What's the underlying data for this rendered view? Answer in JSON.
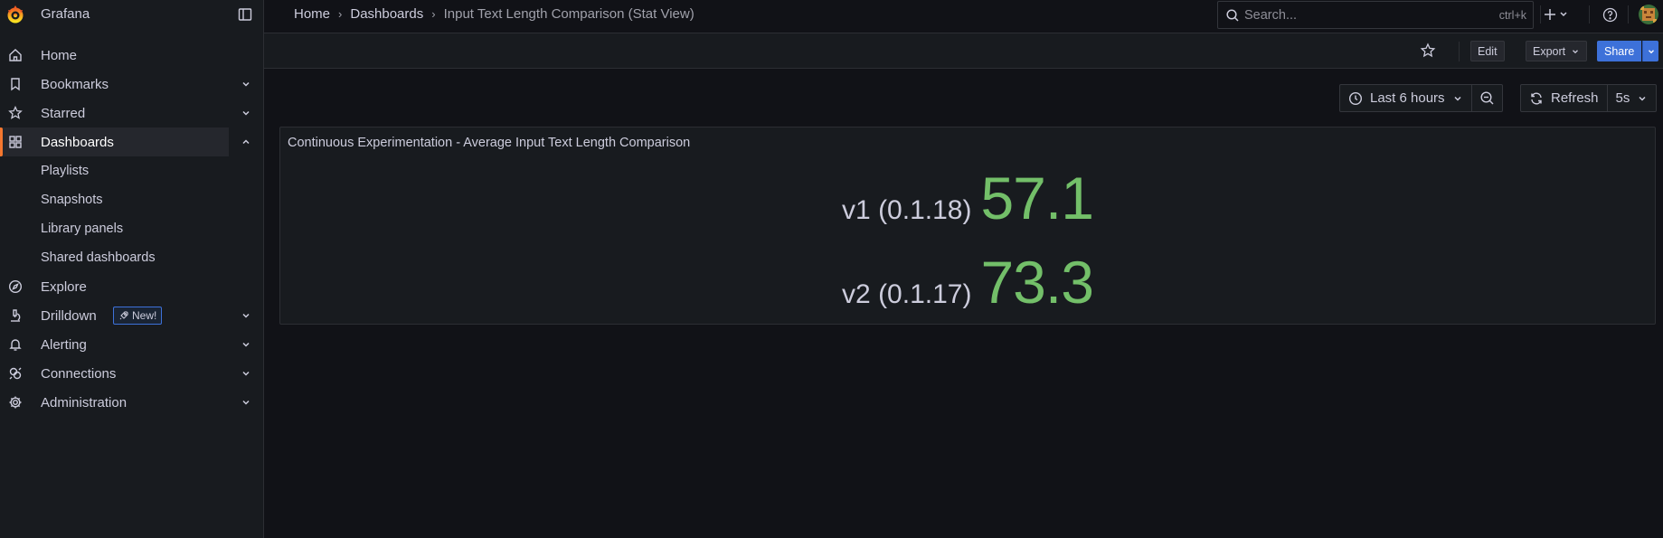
{
  "app": {
    "title": "Grafana"
  },
  "nav": {
    "items": [
      {
        "label": "Home",
        "icon": "home-icon"
      },
      {
        "label": "Bookmarks",
        "icon": "bookmark-icon"
      },
      {
        "label": "Starred",
        "icon": "star-icon"
      },
      {
        "label": "Dashboards",
        "icon": "apps-icon"
      },
      {
        "label": "Playlists"
      },
      {
        "label": "Snapshots"
      },
      {
        "label": "Library panels"
      },
      {
        "label": "Shared dashboards"
      },
      {
        "label": "Explore",
        "icon": "compass-icon"
      },
      {
        "label": "Drilldown",
        "icon": "microscope-icon",
        "badge": "New!"
      },
      {
        "label": "Alerting",
        "icon": "bell-icon"
      },
      {
        "label": "Connections",
        "icon": "plug-icon"
      },
      {
        "label": "Administration",
        "icon": "cog-icon"
      }
    ]
  },
  "breadcrumb": [
    {
      "label": "Home"
    },
    {
      "label": "Dashboards"
    },
    {
      "label": "Input Text Length Comparison (Stat View)"
    }
  ],
  "search": {
    "placeholder": "Search...",
    "shortcut": "ctrl+k"
  },
  "toolbar": {
    "edit_label": "Edit",
    "export_label": "Export",
    "share_label": "Share"
  },
  "time_controls": {
    "range_label": "Last 6 hours",
    "refresh_label": "Refresh",
    "interval_label": "5s"
  },
  "panel": {
    "title": "Continuous Experimentation - Average Input Text Length Comparison",
    "stats": [
      {
        "name": "v1 (0.1.18)",
        "value": "57.1"
      },
      {
        "name": "v2 (0.1.17)",
        "value": "73.3"
      }
    ],
    "value_color": "#73bf69"
  },
  "colors": {
    "accent": "#f5772f",
    "primary": "#3d71d9",
    "background": "#111217",
    "surface": "#181b1f"
  }
}
